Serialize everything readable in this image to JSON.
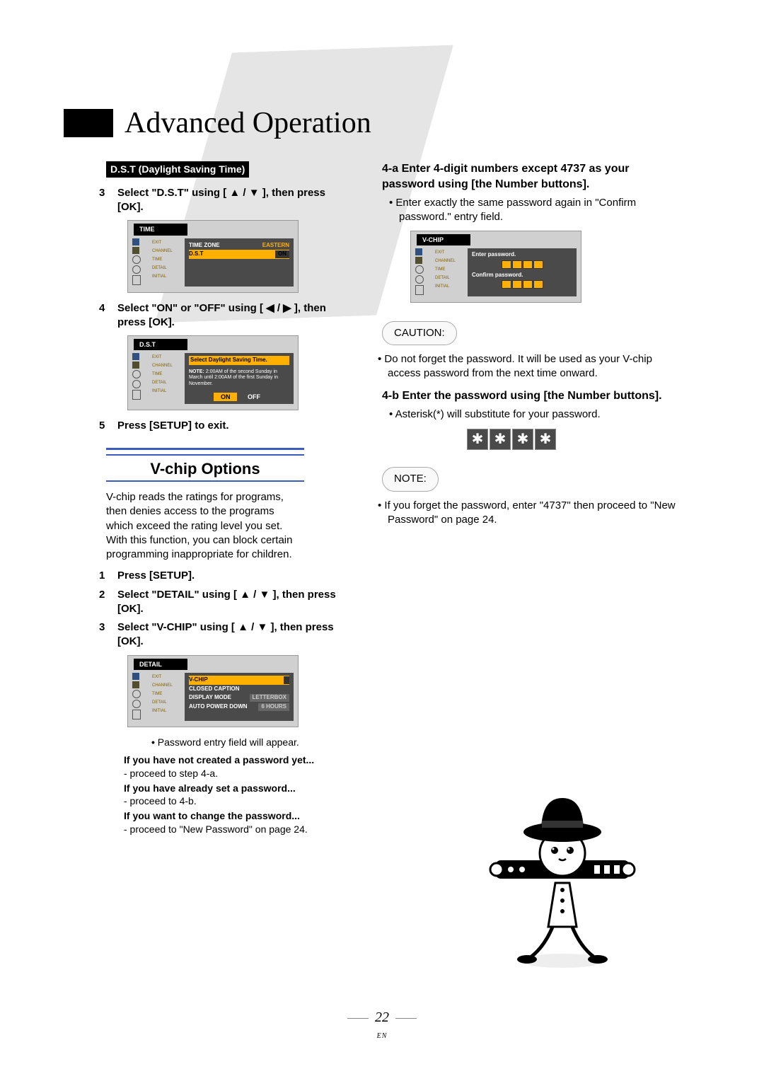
{
  "header": {
    "title": "Advanced Operation"
  },
  "left": {
    "badge": "D.S.T (Daylight Saving Time)",
    "step3_num": "3",
    "step3_text": "Select \"D.S.T\" using [ ▲ / ▼ ], then press [OK].",
    "osd1": {
      "title": "TIME",
      "side_labels": [
        "EXIT",
        "CHANNEL",
        "TIME",
        "DETAIL",
        "INITIAL"
      ],
      "rows": [
        {
          "label": "TIME ZONE",
          "value": "EASTERN",
          "selected": false
        },
        {
          "label": "D.S.T",
          "value": "ON",
          "selected": true
        }
      ]
    },
    "step4_num": "4",
    "step4_text": "Select \"ON\" or \"OFF\" using [ ◀ / ▶ ], then press [OK].",
    "osd2": {
      "title": "D.S.T",
      "side_labels": [
        "EXIT",
        "CHANNEL",
        "TIME",
        "DETAIL",
        "INITIAL"
      ],
      "banner": "Select Daylight Saving Time.",
      "note_title": "NOTE:",
      "note_body": "2:00AM of the second Sunday in March until 2:00AM of the first Sunday in November.",
      "on": "ON",
      "off": "OFF"
    },
    "step5_num": "5",
    "step5_text": "Press [SETUP] to exit.",
    "section_title": "V-chip Options",
    "vchip_intro": "V-chip reads the ratings for programs, then denies access to the programs which exceed the rating level you set. With this function, you can block certain programming inappropriate for children.",
    "vstep1_num": "1",
    "vstep1_text": "Press [SETUP].",
    "vstep2_num": "2",
    "vstep2_text": "Select \"DETAIL\" using [ ▲ / ▼ ], then press [OK].",
    "vstep3_num": "3",
    "vstep3_text": "Select \"V-CHIP\" using [ ▲ / ▼ ], then press [OK].",
    "osd3": {
      "title": "DETAIL",
      "side_labels": [
        "EXIT",
        "CHANNEL",
        "TIME",
        "DETAIL",
        "INITIAL"
      ],
      "rows": [
        {
          "label": "V-CHIP",
          "value": "",
          "selected": true
        },
        {
          "label": "CLOSED CAPTION",
          "value": "",
          "selected": false
        },
        {
          "label": "DISPLAY MODE",
          "value": "LETTERBOX",
          "selected": false
        },
        {
          "label": "AUTO POWER DOWN",
          "value": "6 HOURS",
          "selected": false
        }
      ]
    },
    "bullet_pw": "Password entry field will appear.",
    "bold1": "If you have not created a password yet...",
    "plain1": "- proceed to step 4-a.",
    "bold2": "If you have already set a password...",
    "plain2": "- proceed to 4-b.",
    "bold3": "If you want to change the password...",
    "plain3": "- proceed to \"New Password\" on page 24."
  },
  "right": {
    "step4a": "4-a Enter 4-digit numbers except 4737 as your password using [the Number buttons].",
    "bullet4a": "Enter exactly the same password again in \"Confirm password.\" entry field.",
    "osd4": {
      "title": "V-CHIP",
      "side_labels": [
        "EXIT",
        "CHANNEL",
        "TIME",
        "DETAIL",
        "INITIAL"
      ],
      "enter_label": "Enter password.",
      "confirm_label": "Confirm password."
    },
    "caution_label": "CAUTION:",
    "caution_text": "Do not forget the password. It will be used as your V-chip access password from the next time onward.",
    "step4b": "4-b Enter the password using [the Number buttons].",
    "bullet4b": "Asterisk(*) will substitute for your password.",
    "pw_asterisk": "✱",
    "note_label": "NOTE:",
    "note_text": "If you forget the password, enter \"4737\" then proceed to \"New Password\" on page 24."
  },
  "footer": {
    "page": "22",
    "lang": "EN"
  }
}
